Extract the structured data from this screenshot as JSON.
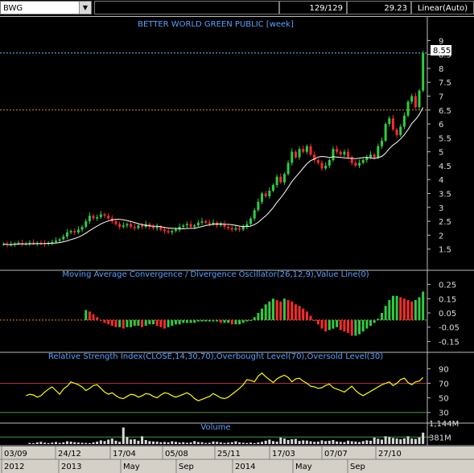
{
  "toolbar": {
    "symbol": "BWG",
    "count": "129/129",
    "price": "29.23",
    "scale": "Linear(Auto)"
  },
  "colors": {
    "up": "#2ecc40",
    "down": "#ff2a2a",
    "ma_line": "#ffffff",
    "title": "#5aa0ff",
    "rsi_line": "#ffff00",
    "grid": "#444444",
    "price_dashed": "#5fc8ff",
    "orange_dashed": "#e08a20"
  },
  "chart_data": [
    {
      "type": "candlestick",
      "title": "BETTER WORLD GREEN PUBLIC [week]",
      "ylim": [
        1.2,
        9.3
      ],
      "yticks": [
        "9",
        "8.5",
        "8",
        "7.5",
        "7",
        "6.5",
        "6",
        "5.5",
        "5",
        "4.5",
        "4",
        "3.5",
        "3",
        "2.5",
        "2",
        "1.5"
      ],
      "ytick_values": [
        9,
        8.5,
        8,
        7.5,
        7,
        6.5,
        6,
        5.5,
        5,
        4.5,
        4,
        3.5,
        3,
        2.5,
        2,
        1.5
      ],
      "last_value_label": "8.55",
      "reference_lines": [
        8.55,
        6.5
      ],
      "close": [
        1.68,
        1.65,
        1.66,
        1.7,
        1.72,
        1.68,
        1.7,
        1.73,
        1.7,
        1.72,
        1.7,
        1.68,
        1.72,
        1.75,
        1.8,
        1.85,
        1.95,
        2.1,
        2.15,
        2.1,
        2.2,
        2.3,
        2.5,
        2.7,
        2.6,
        2.65,
        2.75,
        2.7,
        2.6,
        2.5,
        2.4,
        2.3,
        2.35,
        2.4,
        2.3,
        2.25,
        2.35,
        2.3,
        2.4,
        2.3,
        2.25,
        2.3,
        2.2,
        2.15,
        2.1,
        2.15,
        2.2,
        2.3,
        2.35,
        2.4,
        2.3,
        2.35,
        2.45,
        2.5,
        2.45,
        2.4,
        2.45,
        2.35,
        2.4,
        2.3,
        2.25,
        2.2,
        2.25,
        2.2,
        2.3,
        2.4,
        2.6,
        2.9,
        3.2,
        3.5,
        3.4,
        3.6,
        3.8,
        4.1,
        3.9,
        4.2,
        4.6,
        5.0,
        4.8,
        5.1,
        5.0,
        5.2,
        4.9,
        4.7,
        4.6,
        4.4,
        4.5,
        4.7,
        5.1,
        5.0,
        4.9,
        5.0,
        4.8,
        4.6,
        4.5,
        4.6,
        4.7,
        4.8,
        4.9,
        4.8,
        5.2,
        5.4,
        6.0,
        6.2,
        5.8,
        5.6,
        5.9,
        6.3,
        6.8,
        7.0,
        6.6,
        7.2,
        8.55
      ],
      "ma_note": "white moving-average line"
    },
    {
      "type": "histogram",
      "title": "Moving Average Convergence / Divergence Oscillator(26,12,9),Value Line(0)",
      "ylim": [
        -0.17,
        0.27
      ],
      "yticks": [
        "0.25",
        "0.15",
        "0.05",
        "-0.05",
        "-0.15"
      ],
      "ytick_values": [
        0.25,
        0.15,
        0.05,
        -0.05,
        -0.15
      ],
      "values": [
        0.07,
        0.06,
        0.04,
        0.02,
        0.0,
        -0.02,
        -0.03,
        -0.04,
        -0.05,
        -0.05,
        -0.06,
        -0.05,
        -0.05,
        -0.04,
        -0.04,
        -0.05,
        -0.04,
        -0.03,
        -0.03,
        -0.04,
        -0.05,
        -0.06,
        -0.05,
        -0.04,
        -0.03,
        -0.03,
        -0.02,
        -0.02,
        -0.02,
        -0.02,
        -0.01,
        -0.01,
        -0.01,
        -0.01,
        -0.01,
        -0.01,
        -0.02,
        -0.02,
        -0.02,
        -0.03,
        -0.03,
        -0.03,
        -0.02,
        -0.01,
        0.0,
        0.02,
        0.05,
        0.08,
        0.11,
        0.13,
        0.15,
        0.14,
        0.13,
        0.15,
        0.14,
        0.13,
        0.11,
        0.1,
        0.08,
        0.06,
        0.03,
        0.0,
        -0.03,
        -0.06,
        -0.08,
        -0.07,
        -0.06,
        -0.05,
        -0.07,
        -0.08,
        -0.09,
        -0.11,
        -0.11,
        -0.1,
        -0.08,
        -0.06,
        -0.04,
        -0.02,
        0.01,
        0.05,
        0.1,
        0.14,
        0.17,
        0.17,
        0.16,
        0.15,
        0.14,
        0.13,
        0.14,
        0.16,
        0.2
      ]
    },
    {
      "type": "line",
      "title": "Relative Strength Index(CLOSE,14,30,70),Overbought Level(70),Oversold Level(30)",
      "ylim": [
        22,
        97
      ],
      "yticks": [
        "90",
        "70",
        "50",
        "30"
      ],
      "ytick_values": [
        90,
        70,
        50,
        30
      ],
      "levels": [
        70,
        30
      ],
      "values": [
        53,
        55,
        54,
        51,
        53,
        58,
        62,
        65,
        60,
        55,
        62,
        66,
        72,
        70,
        68,
        65,
        60,
        63,
        67,
        68,
        63,
        58,
        55,
        57,
        53,
        50,
        49,
        52,
        55,
        54,
        51,
        53,
        56,
        55,
        52,
        50,
        54,
        57,
        56,
        53,
        51,
        53,
        55,
        57,
        54,
        49,
        46,
        48,
        50,
        52,
        56,
        53,
        50,
        49,
        51,
        55,
        59,
        63,
        68,
        75,
        74,
        72,
        80,
        84,
        79,
        75,
        71,
        76,
        79,
        81,
        78,
        72,
        76,
        77,
        73,
        70,
        66,
        65,
        63,
        64,
        67,
        69,
        64,
        62,
        60,
        58,
        62,
        66,
        60,
        56,
        53,
        56,
        59,
        62,
        65,
        68,
        70,
        72,
        67,
        70,
        75,
        77,
        71,
        68,
        72,
        73,
        78
      ]
    },
    {
      "type": "bar",
      "title": "Volume",
      "yticks": [
        "1,144M",
        "381M"
      ],
      "ytick_values": [
        1144,
        381
      ],
      "ylim": [
        0,
        1400
      ],
      "values": [
        60,
        40,
        90,
        120,
        70,
        50,
        80,
        110,
        60,
        90,
        150,
        130,
        100,
        80,
        70,
        60,
        50,
        90,
        130,
        200,
        160,
        240,
        300,
        180,
        120,
        900,
        380,
        250,
        260,
        180,
        420,
        220,
        160,
        140,
        130,
        100,
        110,
        90,
        150,
        120,
        80,
        100,
        70,
        90,
        160,
        110,
        100,
        60,
        70,
        140,
        120,
        90,
        60,
        80,
        100,
        150,
        90,
        70,
        60,
        80,
        50,
        90,
        120,
        180,
        240,
        160,
        130,
        350,
        300,
        220,
        260,
        280,
        170,
        200,
        190,
        150,
        120,
        130,
        200,
        160,
        180,
        220,
        140,
        120,
        110,
        180,
        150,
        130,
        110,
        160,
        200,
        180,
        350,
        290,
        240,
        420,
        380,
        330,
        300,
        260,
        310,
        420,
        300,
        280,
        360,
        620
      ],
      "volume_line": 381
    }
  ],
  "x_axis": {
    "top_labels": [
      "03/09",
      "24/12",
      "17/04",
      "05/08",
      "25/11",
      "17/03",
      "07/07",
      "27/10"
    ],
    "top_values": [
      "03/09",
      "24/12",
      "17/04",
      "05/08",
      "25/11",
      "17/03",
      "07/07",
      "27/10"
    ],
    "bottom_labels": [
      "2012",
      "2013",
      "May",
      "Sep",
      "2014",
      "May",
      "Sep"
    ],
    "bottom_values": [
      "2012",
      "2013",
      "May",
      "Sep",
      "2014",
      "May",
      "Sep"
    ]
  }
}
